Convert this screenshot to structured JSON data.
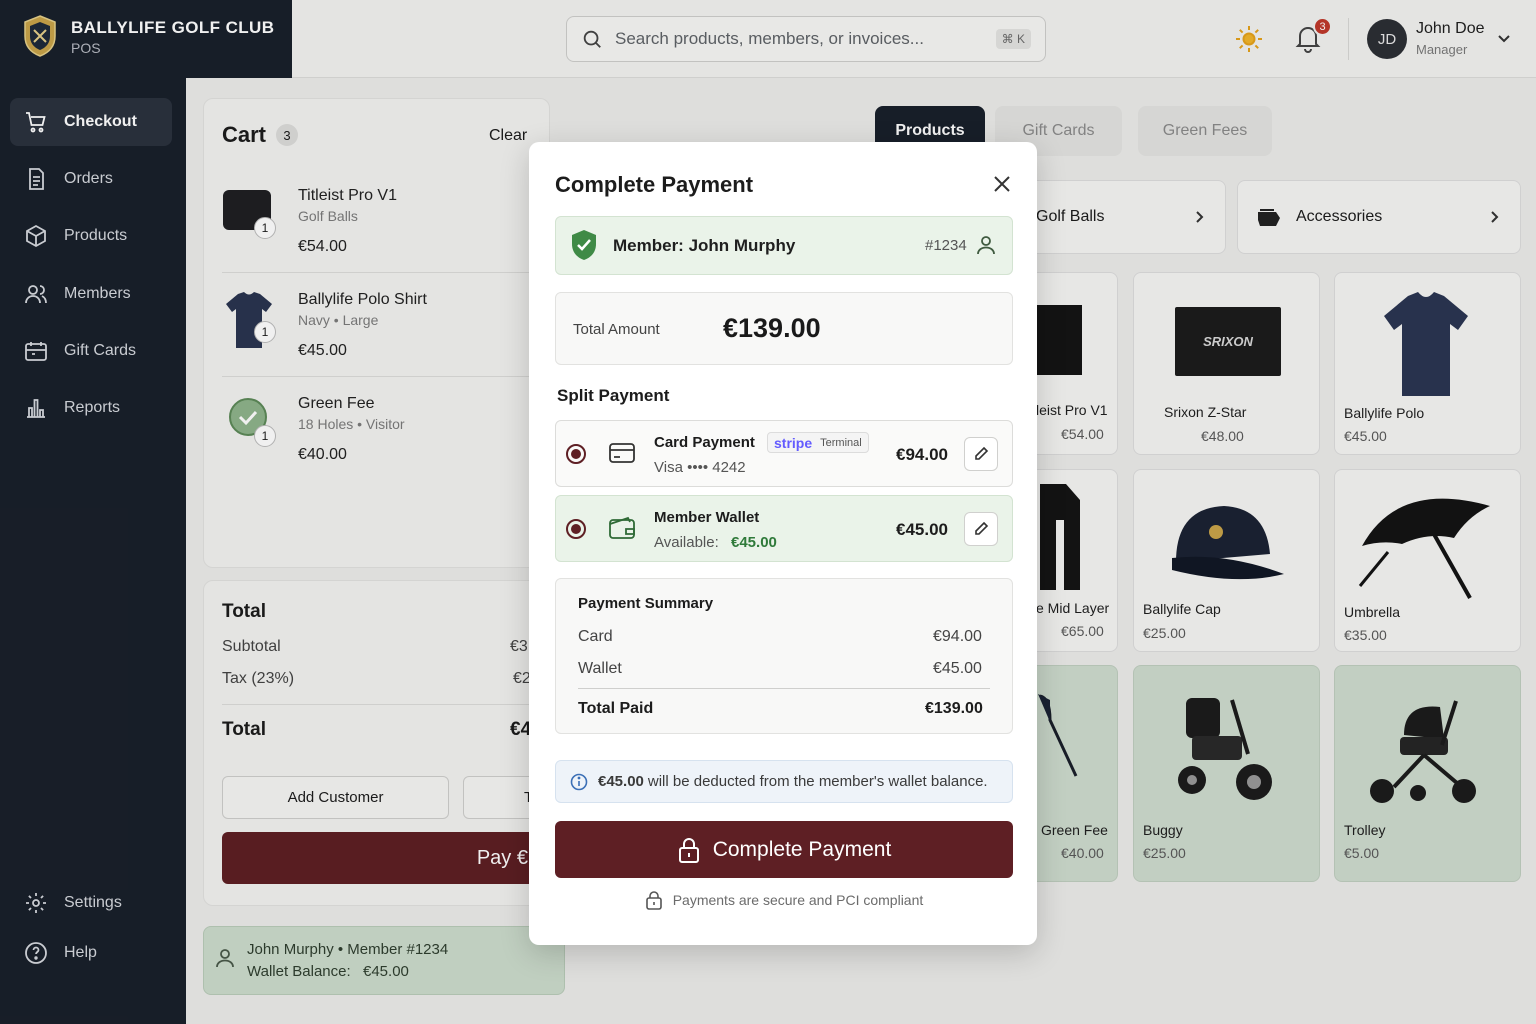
{
  "brand": {
    "name": "BALLYLIFE GOLF CLUB",
    "sub": "POS"
  },
  "nav": {
    "checkout": "Checkout",
    "orders": "Orders",
    "products": "Products",
    "members": "Members",
    "gift_cards": "Gift Cards",
    "reports": "Reports",
    "settings": "Settings",
    "help": "Help"
  },
  "search": {
    "placeholder": "Search products, members, or invoices...",
    "shortcut": "⌘ K"
  },
  "notifications": {
    "count": "3"
  },
  "user": {
    "initials": "JD",
    "name": "John Doe",
    "role": "Manager"
  },
  "cart": {
    "title": "Cart",
    "count": "3",
    "clear_label": "Clear",
    "items": [
      {
        "name": "Titleist Pro V1",
        "meta": "Golf Balls",
        "price": "€54.00",
        "qty": "1"
      },
      {
        "name": "Ballylife Polo Shirt",
        "meta": "Navy • Large",
        "price": "€45.00",
        "qty": "1"
      },
      {
        "name": "Green Fee",
        "meta": "18 Holes • Visitor",
        "price": "€40.00",
        "qty": "1"
      }
    ]
  },
  "totals": {
    "heading": "Total",
    "subtotal_label": "Subtotal",
    "subtotal_value": "€3",
    "tax_label": "Tax (23%)",
    "tax_value": "€2",
    "total_label": "Total",
    "total_value": "€4",
    "add_customer": "Add Customer",
    "second_button": "T",
    "pay_label": "Pay €"
  },
  "customer": {
    "line1": "John Murphy • Member #1234",
    "wallet_label": "Wallet Balance:",
    "wallet_value": "€45.00"
  },
  "tabs": [
    "Products",
    "Gift Cards",
    "Green Fees"
  ],
  "categories": [
    {
      "label": "Golf Balls"
    },
    {
      "label": "Accessories"
    }
  ],
  "products": [
    {
      "name": "leist Pro V1",
      "price": "€54.00"
    },
    {
      "name": "Srixon Z-Star",
      "price": "€48.00"
    },
    {
      "name": "Ballylife Polo",
      "price": "€45.00"
    },
    {
      "name": "e Mid Layer",
      "price": "€65.00"
    },
    {
      "name": "Ballylife Cap",
      "price": "€25.00"
    },
    {
      "name": "Umbrella",
      "price": "€35.00"
    },
    {
      "name": "Green Fee",
      "price": "€40.00"
    },
    {
      "name": "Buggy",
      "price": "€25.00"
    },
    {
      "name": "Trolley",
      "price": "€5.00"
    }
  ],
  "modal": {
    "title": "Complete Payment",
    "member_label": "Member: John Murphy",
    "member_id": "#1234",
    "total_label": "Total Amount",
    "total_value": "€139.00",
    "split_title": "Split Payment",
    "card": {
      "title": "Card Payment",
      "provider": "stripe",
      "terminal": "Terminal",
      "detail": "Visa •••• 4242",
      "amount": "€94.00"
    },
    "wallet": {
      "title": "Member Wallet",
      "available_label": "Available:",
      "available_value": "€45.00",
      "amount": "€45.00"
    },
    "summary": {
      "title": "Payment Summary",
      "card_label": "Card",
      "card_value": "€94.00",
      "wallet_label": "Wallet",
      "wallet_value": "€45.00",
      "total_label": "Total Paid",
      "total_value": "€139.00"
    },
    "info": {
      "amount": "€45.00",
      "text": "will be deducted from the member's wallet balance."
    },
    "complete_label": "Complete Payment",
    "secure_text": "Payments are secure and PCI compliant"
  },
  "colors": {
    "brand_dark": "#19202b",
    "accent": "#5e1f24",
    "success": "#2f7a3a"
  }
}
